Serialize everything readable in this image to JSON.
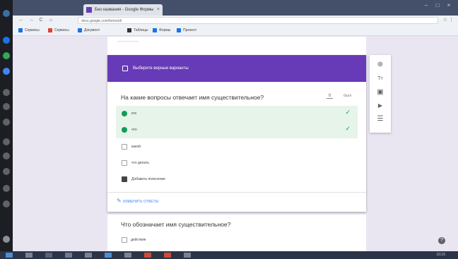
{
  "browser": {
    "tab_title": "Без названия - Google Формы",
    "tab_close": "×",
    "url": "docs.google.com/forms/d/",
    "url_right": "☆ ⋮",
    "nav": {
      "back": "←",
      "forward": "→",
      "reload": "C",
      "home": "⌂"
    },
    "window_controls": {
      "minimize": "–",
      "maximize": "□",
      "close": "×"
    },
    "bookmarks": [
      {
        "label": "Сервисы",
        "color": "#1a73e8"
      },
      {
        "label": "Сервисы",
        "color": "#db4437"
      },
      {
        "label": "Документ",
        "color": "#1a73e8"
      },
      {
        "label": "Таблицы",
        "color": "#333333"
      },
      {
        "label": "Формы",
        "color": "#1a73e8"
      },
      {
        "label": "Презент",
        "color": "#1a73e8"
      }
    ]
  },
  "section": {
    "header_label": "Выберите верные варианты"
  },
  "question": {
    "title": "На какие вопросы отвечает имя существительное?",
    "points_value": "0",
    "points_unit": "балл",
    "options": [
      {
        "label": "кто",
        "state": "correct"
      },
      {
        "label": "что",
        "state": "correct"
      },
      {
        "label": "какой",
        "state": "unchecked"
      },
      {
        "label": "что делать",
        "state": "unchecked"
      },
      {
        "label": "Добавить пояснение",
        "state": "square"
      }
    ],
    "check_icon": "✓",
    "answer_key_icon": "✎",
    "answer_key": "ИЗМЕНИТЬ ОТВЕТЫ"
  },
  "side_tools": {
    "add": "⊕",
    "title": "Тт",
    "image": "▣",
    "video": "▶",
    "section": "☰"
  },
  "next_question": {
    "title": "Что обозначает имя существительное?",
    "first_option": "действие"
  },
  "help_icon": "?",
  "taskbar": {
    "time": "10:15"
  },
  "colors": {
    "accent": "#673ab7",
    "correct": "#0f9d58",
    "correct_bg": "#e6f4ea",
    "page_bg": "#e9e5f1"
  }
}
